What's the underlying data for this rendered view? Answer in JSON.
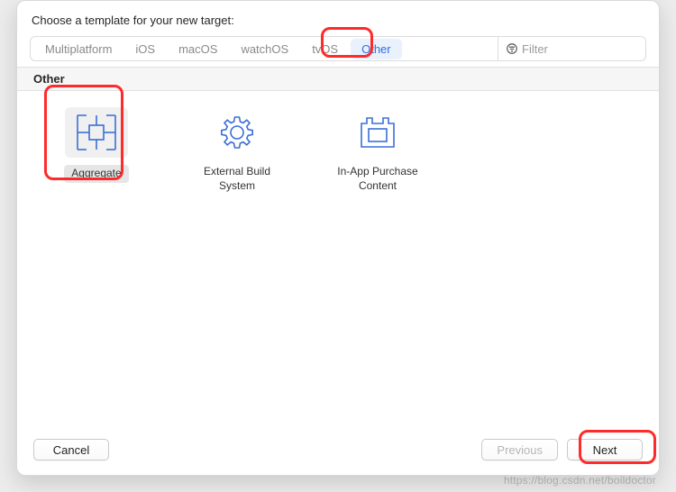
{
  "title": "Choose a template for your new target:",
  "tabs": {
    "multiplatform": "Multiplatform",
    "ios": "iOS",
    "macos": "macOS",
    "watchos": "watchOS",
    "tvos": "tvOS",
    "other": "Other"
  },
  "filter": {
    "placeholder": "Filter"
  },
  "section": {
    "title": "Other"
  },
  "templates": {
    "aggregate": {
      "label": "Aggregate"
    },
    "external_build": {
      "label": "External Build\nSystem"
    },
    "iap_content": {
      "label": "In-App Purchase\nContent"
    }
  },
  "footer": {
    "cancel": "Cancel",
    "previous": "Previous",
    "next": "Next"
  },
  "watermark": "https://blog.csdn.net/boildoctor"
}
